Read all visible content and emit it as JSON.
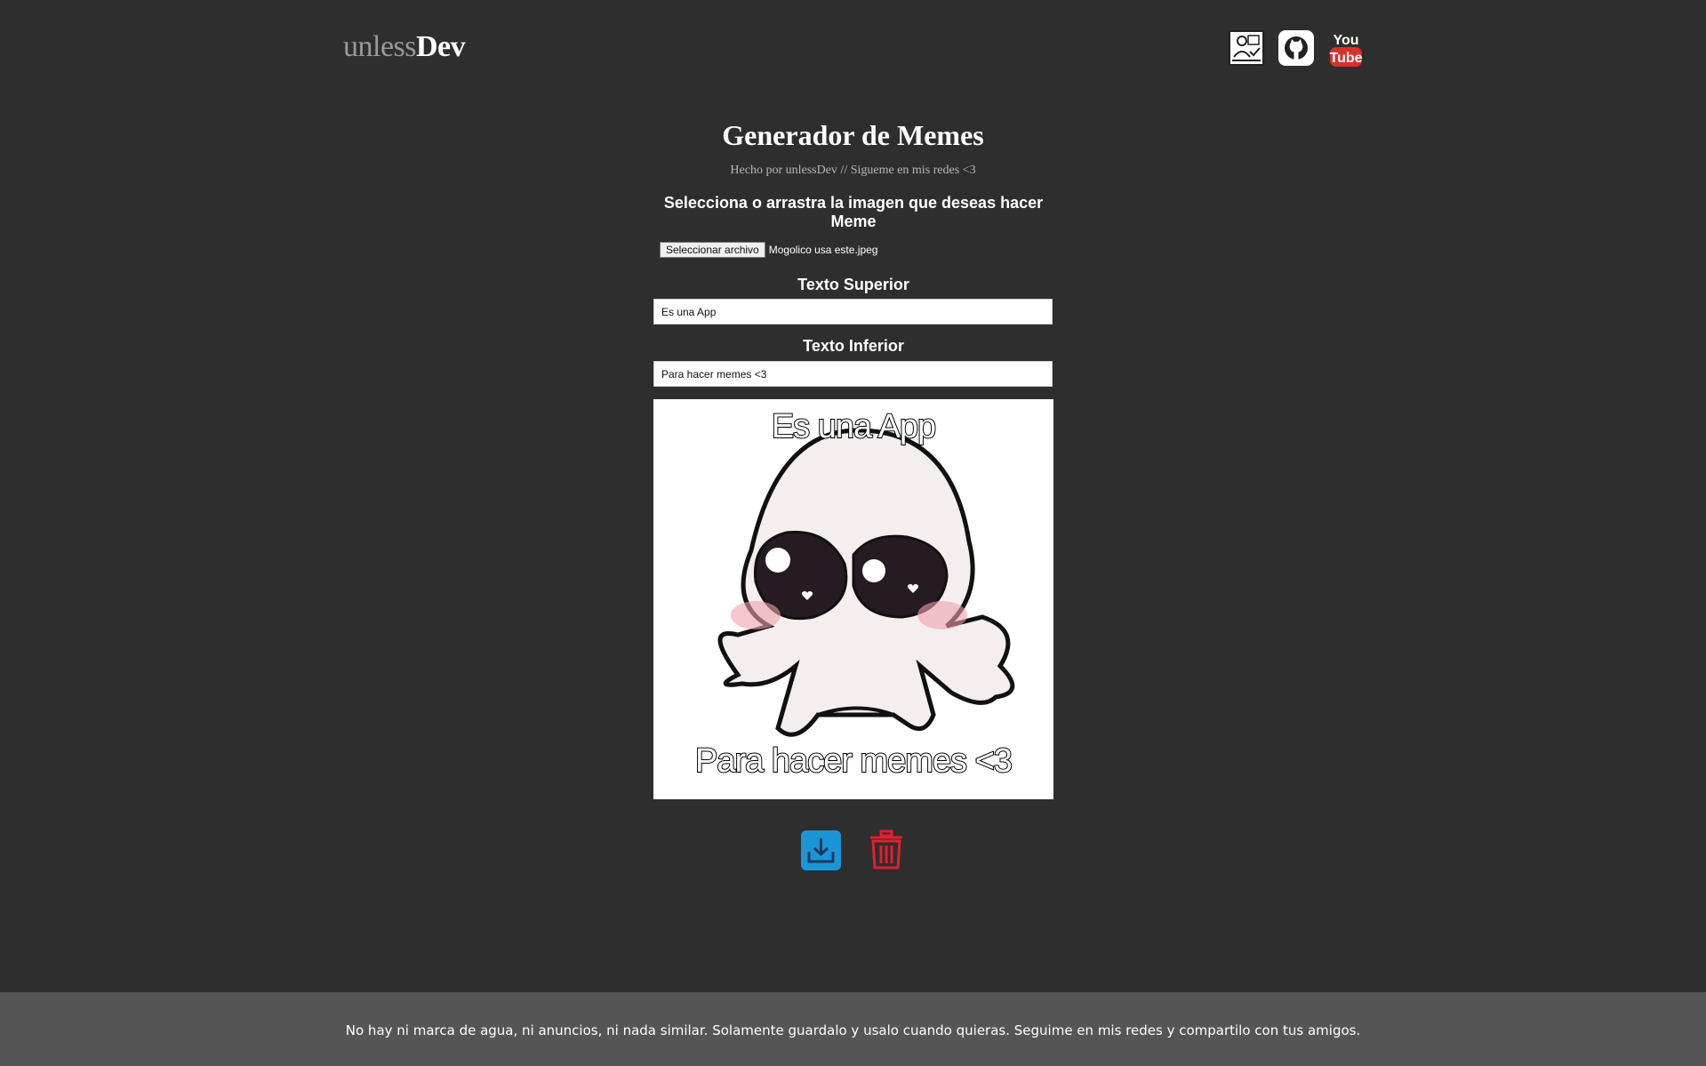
{
  "header": {
    "logo_light": "unless",
    "logo_bold": "Dev",
    "icons": [
      "portfolio-icon",
      "github-icon",
      "youtube-icon"
    ],
    "youtube_you": "You",
    "youtube_tube": "Tube"
  },
  "main": {
    "title": "Generador de Memes",
    "subtitle": "Hecho por unlessDev // Sigueme en mis redes <3",
    "select_label": "Selecciona o arrastra la imagen que deseas hacer Meme",
    "file_button": "Seleccionar archivo",
    "file_name": "Mogolico usa este.jpeg",
    "top_label": "Texto Superior",
    "top_value": "Es una App",
    "bottom_label": "Texto Inferior",
    "bottom_value": "Para hacer memes <3"
  },
  "meme": {
    "top_text": "Es una App",
    "bottom_text": "Para hacer memes <3"
  },
  "actions": {
    "download_icon": "download-icon",
    "delete_icon": "trash-icon"
  },
  "footer": {
    "text": "No hay ni marca de agua, ni anuncios, ni nada similar. Solamente guardalo y usalo cuando quieras. Seguime en mis redes y compartilo con tus amigos."
  },
  "colors": {
    "background": "#2e2e2e",
    "footer": "#555555",
    "download": "#1a96d8",
    "delete": "#e0202e",
    "youtube": "#d9302b"
  }
}
